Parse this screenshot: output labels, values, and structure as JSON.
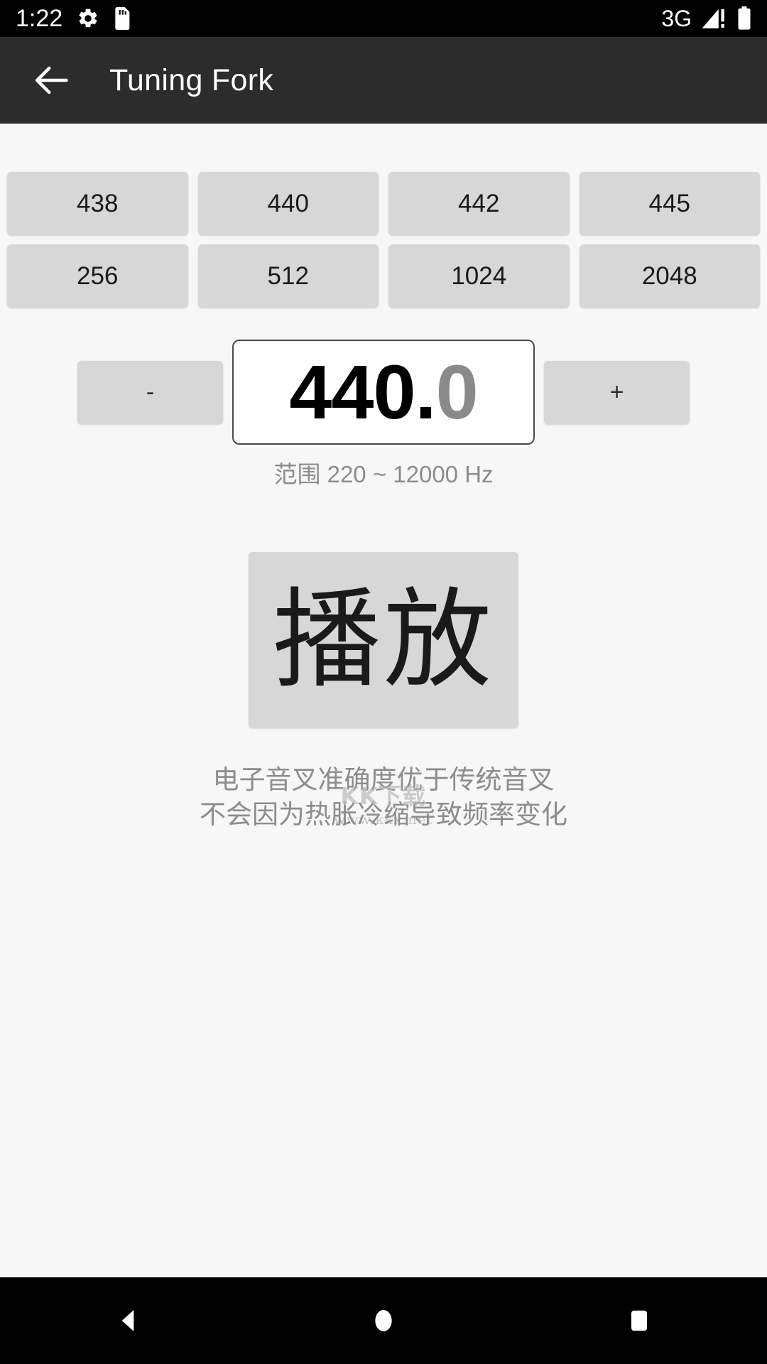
{
  "status_bar": {
    "clock": "1:22",
    "left_icons": [
      "gear-icon",
      "sd-card-icon"
    ],
    "network_label": "3G",
    "right_icons": [
      "signal-warning-icon",
      "battery-icon"
    ],
    "background": "#000000",
    "foreground": "#ffffff"
  },
  "app_bar": {
    "back_icon": "back-arrow-icon",
    "title": "Tuning Fork",
    "background": "#2c2c2c",
    "foreground": "#ffffff"
  },
  "presets": {
    "row1": [
      "438",
      "440",
      "442",
      "445"
    ],
    "row2": [
      "256",
      "512",
      "1024",
      "2048"
    ],
    "button_color": "#d7d7d7",
    "text_color": "#1a1a1a"
  },
  "stepper": {
    "decrement_label": "-",
    "increment_label": "+"
  },
  "frequency": {
    "integer_part": "440",
    "decimal_separator": ".",
    "decimal_part": "0",
    "full_value": "440.0",
    "integer_color": "#000000",
    "decimal_color": "#8a8a8a",
    "range_label": "范围 220 ~ 12000 Hz",
    "range_min": "220",
    "range_max": "12000",
    "unit": "Hz"
  },
  "play": {
    "label": "播放",
    "button_color": "#d7d7d7"
  },
  "watermark": {
    "main": "KK下载",
    "sub": "www.kkx.net"
  },
  "description": {
    "line1": "电子音叉准确度优于传统音叉",
    "line2": "不会因为热胀冷缩导致频率变化"
  },
  "nav_bar": {
    "back_icon": "nav-back-triangle-icon",
    "home_icon": "nav-home-circle-icon",
    "recents_icon": "nav-recents-square-icon",
    "background": "#000000"
  }
}
